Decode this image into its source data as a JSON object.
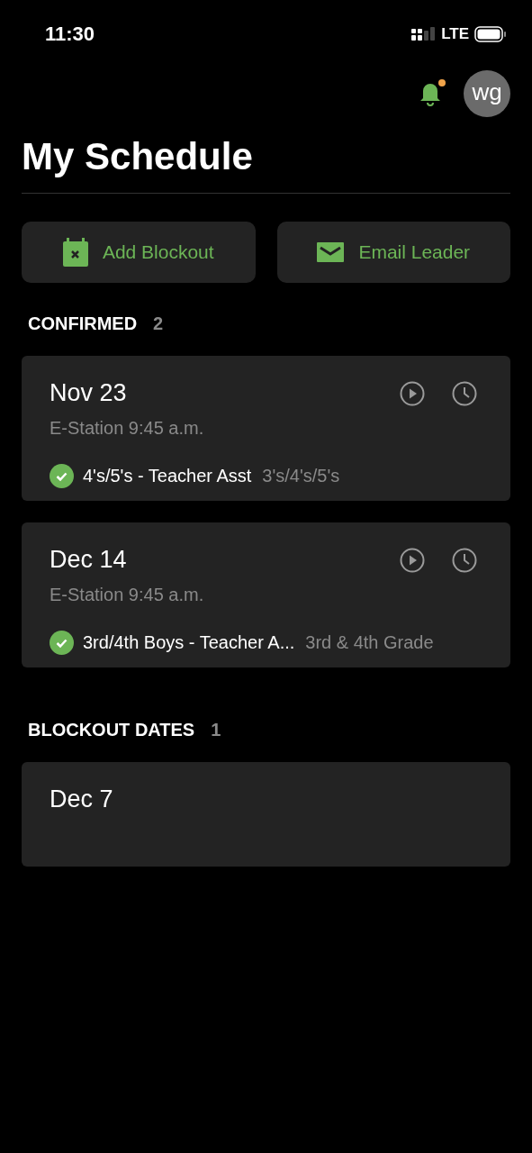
{
  "status_bar": {
    "time": "11:30",
    "network": "LTE"
  },
  "header": {
    "notifications_unread": true,
    "avatar_initials": "wg"
  },
  "title": "My Schedule",
  "actions": [
    {
      "kind": "calendar",
      "label": "Add Blockout"
    },
    {
      "kind": "mail",
      "label": "Email Leader"
    }
  ],
  "sections": [
    {
      "title": "CONFIRMED",
      "count": "2",
      "cards": [
        {
          "date": "Nov 23",
          "location": "E-Station 9:45 a.m.",
          "show_actions": true,
          "assignment": {
            "confirmed": true,
            "role": "4's/5's - Teacher Asst",
            "team": "3's/4's/5's"
          }
        },
        {
          "date": "Dec 14",
          "location": "E-Station 9:45 a.m.",
          "show_actions": true,
          "assignment": {
            "confirmed": true,
            "role": "3rd/4th Boys - Teacher A...",
            "team": "3rd & 4th Grade"
          }
        }
      ]
    },
    {
      "title": "BLOCKOUT DATES",
      "count": "1",
      "cards": [
        {
          "date": "Dec 7",
          "show_actions": false
        }
      ]
    }
  ]
}
